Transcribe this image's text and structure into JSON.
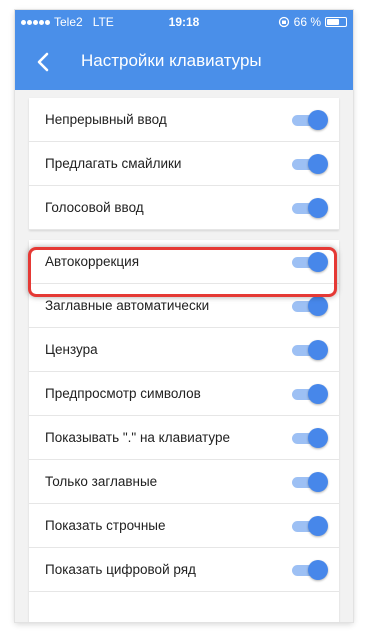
{
  "status_bar": {
    "carrier": "Tele2",
    "network": "LTE",
    "time": "19:18",
    "battery": "66 %",
    "battery_level": 0.66
  },
  "header": {
    "back_icon": "chevron-left-icon",
    "title": "Настройки клавиатуры"
  },
  "colors": {
    "primary": "#4a8fe9",
    "switch_on": "#4787ea",
    "highlight": "#e53935"
  },
  "group1": [
    {
      "label": "Непрерывный ввод",
      "on": true
    },
    {
      "label": "Предлагать смайлики",
      "on": true
    },
    {
      "label": "Голосовой ввод",
      "on": true
    }
  ],
  "group2": [
    {
      "label": "Автокоррекция",
      "on": true
    },
    {
      "label": "Заглавные автоматически",
      "on": true
    },
    {
      "label": "Цензура",
      "on": true
    },
    {
      "label": "Предпросмотр символов",
      "on": true
    },
    {
      "label": "Показывать \".\" на клавиатуре",
      "on": true
    },
    {
      "label": "Только заглавные",
      "on": true
    },
    {
      "label": "Показать строчные",
      "on": true
    },
    {
      "label": "Показать цифровой ряд",
      "on": true
    }
  ]
}
